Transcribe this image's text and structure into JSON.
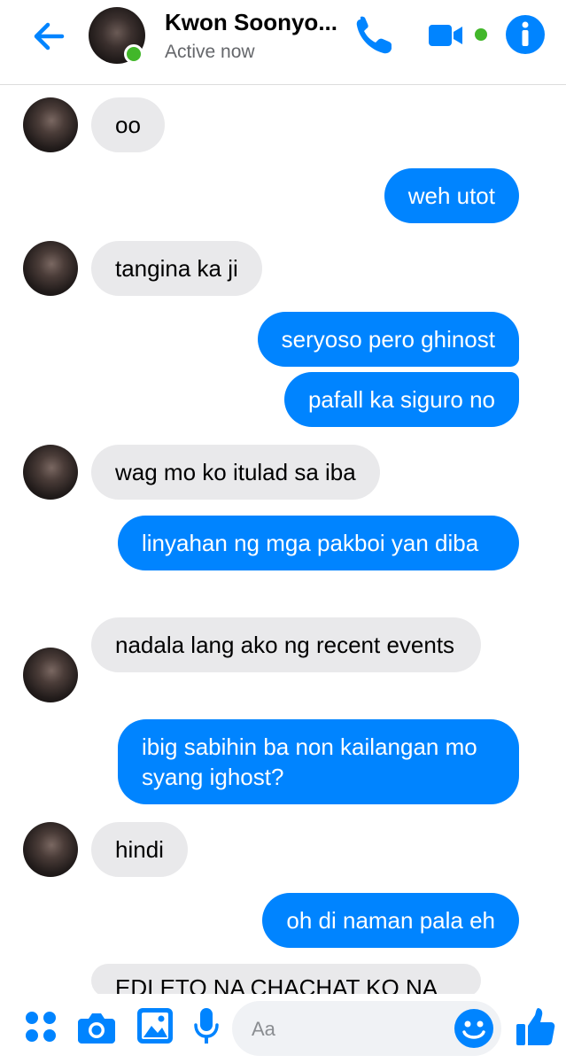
{
  "header": {
    "name": "Kwon Soonyo...",
    "status": "Active now",
    "icons": [
      "back-arrow-icon",
      "phone-icon",
      "video-camera-icon",
      "info-icon"
    ]
  },
  "colors": {
    "accent": "#0084ff",
    "incoming_bubble": "#e9e9eb",
    "online": "#42b72a"
  },
  "messages": [
    {
      "from": "them",
      "text": "oo"
    },
    {
      "from": "me",
      "text": "weh utot"
    },
    {
      "from": "them",
      "text": "tangina ka ji"
    },
    {
      "from": "me",
      "text": "seryoso pero ghinost"
    },
    {
      "from": "me",
      "text": "pafall ka siguro no"
    },
    {
      "from": "them",
      "text": "wag mo ko itulad sa iba"
    },
    {
      "from": "me",
      "text": "linyahan ng mga pakboi yan diba"
    },
    {
      "from": "them",
      "text": "nadala lang ako ng recent events"
    },
    {
      "from": "me",
      "text": "ibig sabihin ba non kailangan mo syang ighost?"
    },
    {
      "from": "them",
      "text": "hindi"
    },
    {
      "from": "me",
      "text": "oh di naman pala eh"
    },
    {
      "from": "them",
      "text": "EDI ETO NA CHACHAT KO NA"
    }
  ],
  "composer": {
    "placeholder": "Aa",
    "icons": [
      "apps-dots-icon",
      "camera-icon",
      "gallery-icon",
      "microphone-icon",
      "emoji-icon",
      "thumbs-up-icon"
    ]
  }
}
